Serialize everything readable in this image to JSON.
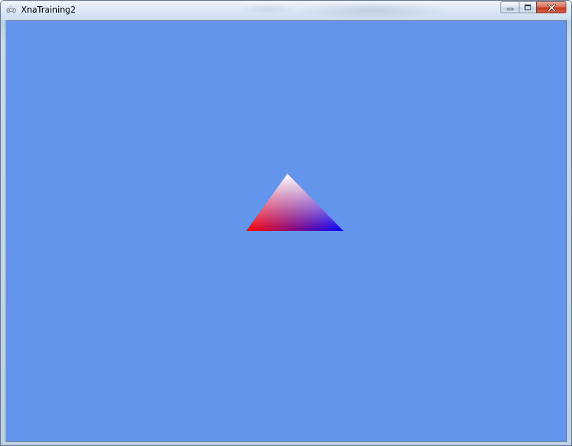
{
  "window": {
    "title": "XnaTraining2",
    "app_icon": "xna-controller-icon",
    "caption_buttons": {
      "minimize_icon": "minimize-icon",
      "maximize_icon": "maximize-icon",
      "close_icon": "close-icon"
    }
  },
  "viewport": {
    "background_color": "#6495ed",
    "triangle": {
      "top_vertex_color": "#ffffff",
      "left_vertex_color": "#ff0000",
      "right_vertex_color": "#0000ff"
    }
  }
}
